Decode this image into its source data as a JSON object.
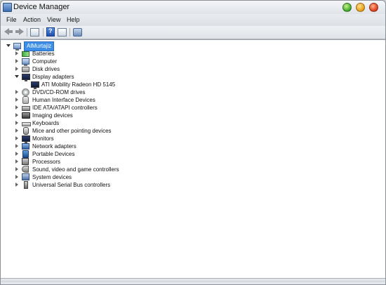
{
  "window": {
    "title": "Device Manager"
  },
  "menu": {
    "items": [
      "File",
      "Action",
      "View",
      "Help"
    ]
  },
  "toolbar": {
    "buttons": [
      "back-arrow-icon",
      "forward-arrow-icon",
      "properties-icon",
      "help-icon",
      "view-icon",
      "scan-hardware-icon"
    ]
  },
  "tree": {
    "root": {
      "label": "AlMurtajiz",
      "icon": "computer-icon"
    },
    "categories": [
      {
        "label": "Batteries",
        "icon": "battery-icon",
        "expanded": false
      },
      {
        "label": "Computer",
        "icon": "computer-icon",
        "expanded": false
      },
      {
        "label": "Disk drives",
        "icon": "disk-drive-icon",
        "expanded": false
      },
      {
        "label": "Display adapters",
        "icon": "display-adapter-icon",
        "expanded": true,
        "children": [
          {
            "label": "ATI Mobility Radeon HD 5145",
            "icon": "display-adapter-icon"
          }
        ]
      },
      {
        "label": "DVD/CD-ROM drives",
        "icon": "dvd-icon",
        "expanded": false
      },
      {
        "label": "Human Interface Devices",
        "icon": "hid-icon",
        "expanded": false
      },
      {
        "label": "IDE ATA/ATAPI controllers",
        "icon": "ide-controller-icon",
        "expanded": false
      },
      {
        "label": "Imaging devices",
        "icon": "imaging-device-icon",
        "expanded": false
      },
      {
        "label": "Keyboards",
        "icon": "keyboard-icon",
        "expanded": false
      },
      {
        "label": "Mice and other pointing devices",
        "icon": "mouse-icon",
        "expanded": false
      },
      {
        "label": "Monitors",
        "icon": "monitor-icon",
        "expanded": false
      },
      {
        "label": "Network adapters",
        "icon": "network-adapter-icon",
        "expanded": false
      },
      {
        "label": "Portable Devices",
        "icon": "portable-device-icon",
        "expanded": false
      },
      {
        "label": "Processors",
        "icon": "processor-icon",
        "expanded": false
      },
      {
        "label": "Sound, video and game controllers",
        "icon": "sound-icon",
        "expanded": false
      },
      {
        "label": "System devices",
        "icon": "system-device-icon",
        "expanded": false
      },
      {
        "label": "Universal Serial Bus controllers",
        "icon": "usb-icon",
        "expanded": false
      }
    ]
  },
  "colors": {
    "selection": "#3d8ee6",
    "window_bg": "#dfe3e8"
  }
}
